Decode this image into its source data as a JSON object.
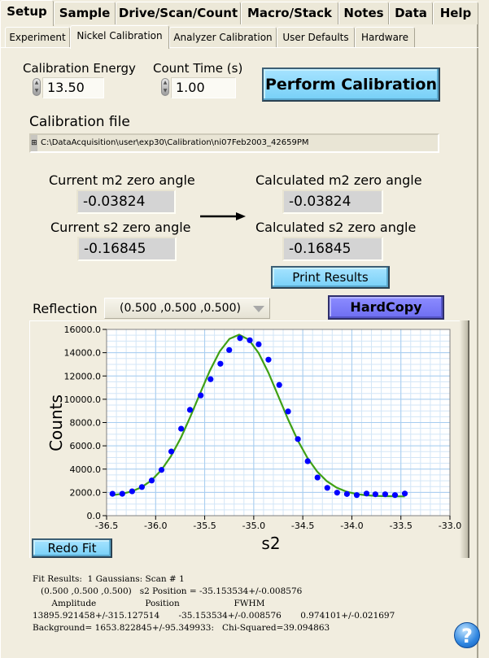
{
  "tabs": [
    {
      "label": "Setup",
      "active": true
    },
    {
      "label": "Sample",
      "active": false
    },
    {
      "label": "Drive/Scan/Count",
      "active": false
    },
    {
      "label": "Macro/Stack",
      "active": false
    },
    {
      "label": "Notes",
      "active": false
    },
    {
      "label": "Data",
      "active": false
    },
    {
      "label": "Help",
      "active": false
    }
  ],
  "subtabs": [
    {
      "label": "Experiment",
      "active": false
    },
    {
      "label": "Nickel Calibration",
      "active": true
    },
    {
      "label": "Analyzer Calibration",
      "active": false
    },
    {
      "label": "User Defaults",
      "active": false
    },
    {
      "label": "Hardware",
      "active": false
    }
  ],
  "controls": {
    "calibration_energy": {
      "label": "Calibration Energy",
      "value": "13.50"
    },
    "count_time": {
      "label": "Count Time (s)",
      "value": "1.00"
    },
    "perform_calibration_label": "Perform Calibration",
    "calibration_file_label": "Calibration file",
    "calibration_file_path": "C:\\DataAcquisition\\user\\exp30\\Calibration\\ni07Feb2003_42659PM"
  },
  "angles": {
    "current_m2": {
      "label": "Current m2 zero angle",
      "value": "-0.03824"
    },
    "current_s2": {
      "label": "Current s2 zero angle",
      "value": "-0.16845"
    },
    "calculated_m2": {
      "label": "Calculated m2 zero angle",
      "value": "-0.03824"
    },
    "calculated_s2": {
      "label": "Calculated s2 zero angle",
      "value": "-0.16845"
    },
    "print_results_label": "Print Results"
  },
  "reflection": {
    "label": "Reflection",
    "selected": "(0.500 ,0.500 ,0.500)"
  },
  "hardcopy_label": "HardCopy",
  "redo_fit_label": "Redo Fit",
  "colors": {
    "points": "#0000ff",
    "fit": "#3fa014",
    "grid_major": "#a7cdf0",
    "grid_minor": "#d3e6f7",
    "button_blue": "#8fdcff",
    "button_purple": "#7c7cf8"
  },
  "chart_data": {
    "type": "scatter",
    "title": "",
    "xlabel": "s2",
    "ylabel": "Counts",
    "xlim": [
      -36.5,
      -33.0
    ],
    "ylim": [
      0,
      16000
    ],
    "xticks": [
      "-36.5",
      "-36.0",
      "-35.5",
      "-35.0",
      "-34.5",
      "-34.0",
      "-33.5",
      "-33.0"
    ],
    "yticks": [
      "0.0",
      "2000.0",
      "4000.0",
      "6000.0",
      "8000.0",
      "10000.0",
      "12000.0",
      "14000.0",
      "16000.0"
    ],
    "grid": true,
    "series": [
      {
        "name": "data",
        "style": "points",
        "x": [
          -36.44,
          -36.34,
          -36.24,
          -36.14,
          -36.04,
          -35.94,
          -35.84,
          -35.74,
          -35.65,
          -35.54,
          -35.44,
          -35.34,
          -35.25,
          -35.14,
          -35.04,
          -34.95,
          -34.85,
          -34.74,
          -34.65,
          -34.55,
          -34.45,
          -34.35,
          -34.25,
          -34.15,
          -34.05,
          -33.95,
          -33.85,
          -33.76,
          -33.66,
          -33.56,
          -33.46
        ],
        "y": [
          1880,
          1880,
          2090,
          2460,
          3020,
          3930,
          5510,
          7470,
          9090,
          10330,
          11720,
          13050,
          14230,
          15250,
          15070,
          14720,
          13400,
          11230,
          8950,
          6580,
          4680,
          3280,
          2390,
          1975,
          1860,
          1770,
          1900,
          1840,
          1840,
          1770,
          1900
        ]
      },
      {
        "name": "gaussian fit",
        "style": "line",
        "amplitude": 13895.921458,
        "position": -35.153534,
        "fwhm": 0.974101,
        "background": 1653.822845,
        "x_range": [
          -36.44,
          -33.46
        ]
      }
    ]
  },
  "fit_results": {
    "lines": [
      "Fit Results:  1 Gaussians: Scan # 1",
      "   (0.500 ,0.500 ,0.500)   s2 Position = -35.153534+/-0.008576",
      "       Amplitude                  Position                    FWHM",
      "13895.921458+/-315.127514       -35.153534+/-0.008576       0.974101+/-0.021697",
      "Background= 1653.822845+/-95.349933:   Chi-Squared=39.094863"
    ]
  },
  "help_icon": "?"
}
